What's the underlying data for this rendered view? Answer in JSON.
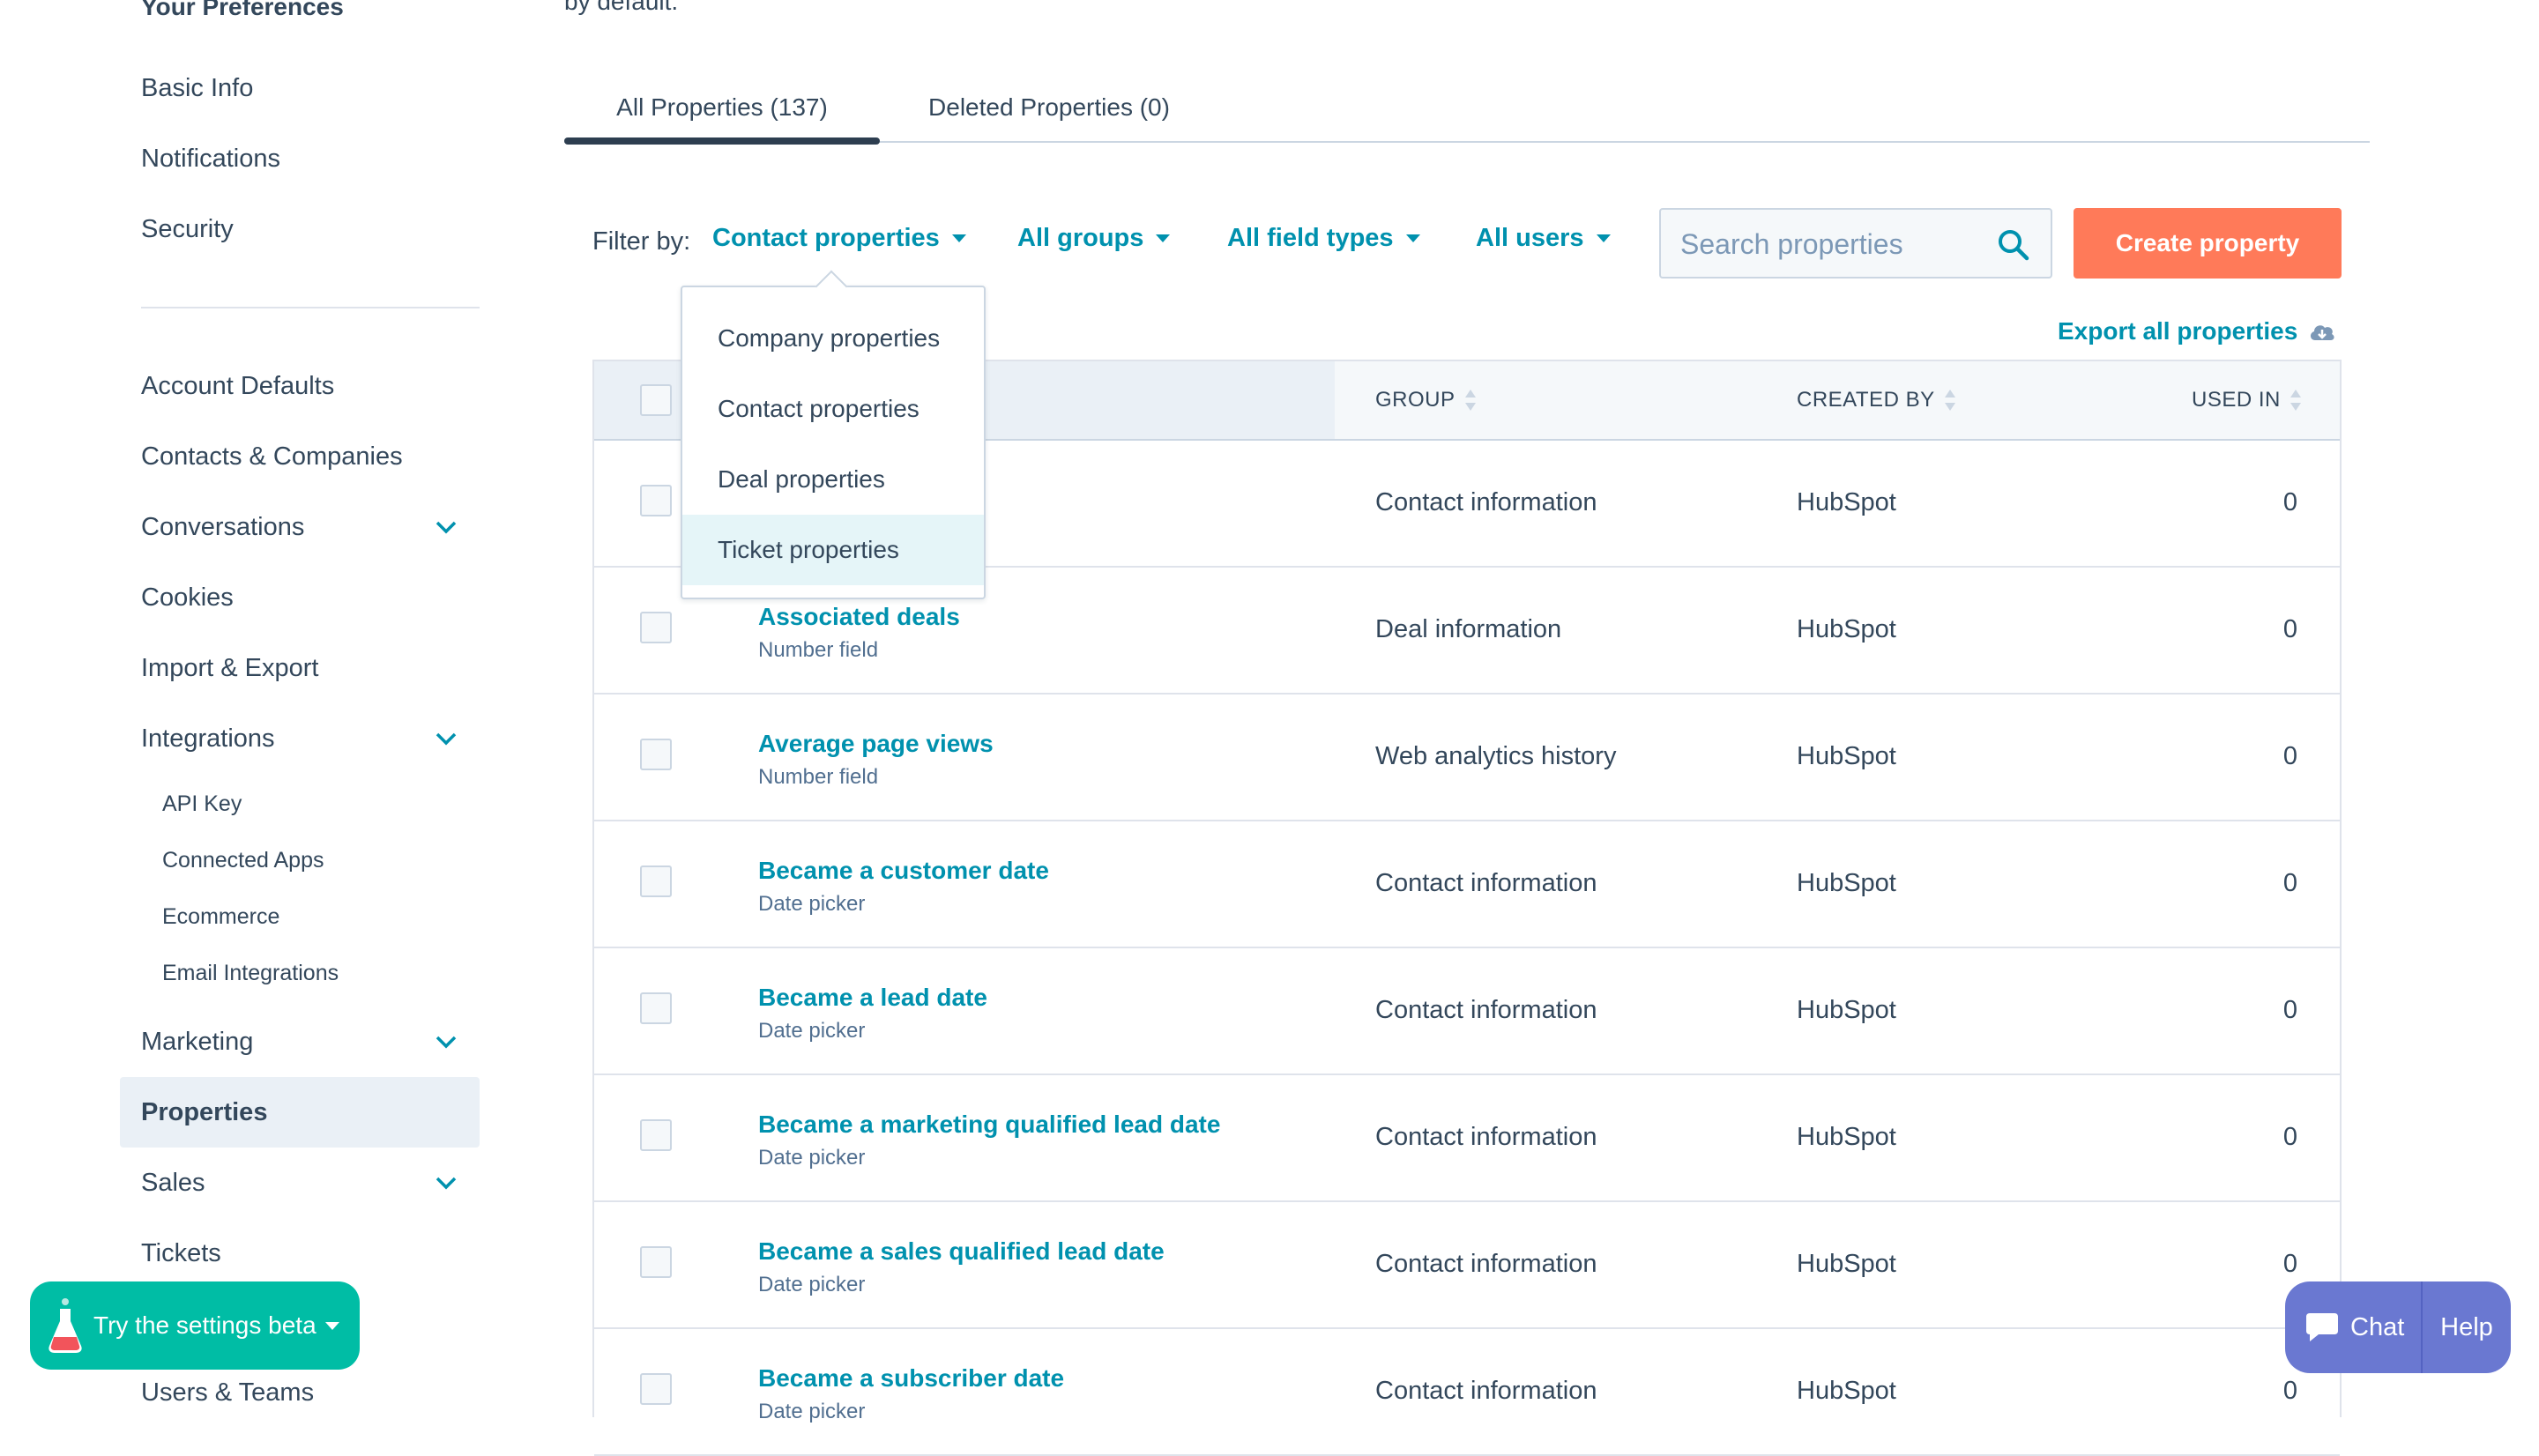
{
  "intro_text": "by default.",
  "sidebar": {
    "heading": "Your Preferences",
    "preferences": [
      {
        "label": "Basic Info"
      },
      {
        "label": "Notifications"
      },
      {
        "label": "Security"
      }
    ],
    "items": [
      {
        "label": "Account Defaults"
      },
      {
        "label": "Contacts & Companies"
      },
      {
        "label": "Conversations"
      },
      {
        "label": "Cookies"
      },
      {
        "label": "Import & Export"
      },
      {
        "label": "Integrations"
      },
      {
        "label": "Marketing"
      },
      {
        "label": "Properties"
      },
      {
        "label": "Sales"
      },
      {
        "label": "Tickets"
      },
      {
        "label": "Users & Teams"
      }
    ],
    "integrations_sub": [
      {
        "label": "API Key"
      },
      {
        "label": "Connected Apps"
      },
      {
        "label": "Ecommerce"
      },
      {
        "label": "Email Integrations"
      }
    ],
    "active_item": "Properties"
  },
  "tabs": [
    {
      "label": "All Properties (137)",
      "active": true
    },
    {
      "label": "Deleted Properties (0)",
      "active": false
    }
  ],
  "filters": {
    "label": "Filter by:",
    "object_type": "Contact properties",
    "groups": "All groups",
    "field_types": "All field types",
    "users": "All users"
  },
  "search": {
    "placeholder": "Search properties",
    "value": ""
  },
  "create_button": "Create property",
  "export_link": "Export all properties",
  "object_menu": {
    "options": [
      {
        "label": "Company properties"
      },
      {
        "label": "Contact properties"
      },
      {
        "label": "Deal properties"
      },
      {
        "label": "Ticket properties"
      }
    ],
    "highlighted": "Ticket properties"
  },
  "table": {
    "columns": {
      "group": "GROUP",
      "created_by": "CREATED BY",
      "used_in": "USED IN"
    },
    "rows": [
      {
        "name": "",
        "type": "",
        "group": "Contact information",
        "created_by": "HubSpot",
        "used_in": "0"
      },
      {
        "name": "Associated deals",
        "type": "Number field",
        "group": "Deal information",
        "created_by": "HubSpot",
        "used_in": "0"
      },
      {
        "name": "Average page views",
        "type": "Number field",
        "group": "Web analytics history",
        "created_by": "HubSpot",
        "used_in": "0"
      },
      {
        "name": "Became a customer date",
        "type": "Date picker",
        "group": "Contact information",
        "created_by": "HubSpot",
        "used_in": "0"
      },
      {
        "name": "Became a lead date",
        "type": "Date picker",
        "group": "Contact information",
        "created_by": "HubSpot",
        "used_in": "0"
      },
      {
        "name": "Became a marketing qualified lead date",
        "type": "Date picker",
        "group": "Contact information",
        "created_by": "HubSpot",
        "used_in": "0"
      },
      {
        "name": "Became a sales qualified lead date",
        "type": "Date picker",
        "group": "Contact information",
        "created_by": "HubSpot",
        "used_in": "0"
      },
      {
        "name": "Became a subscriber date",
        "type": "Date picker",
        "group": "Contact information",
        "created_by": "HubSpot",
        "used_in": "0"
      }
    ]
  },
  "beta_button": "Try the settings beta",
  "chat_widget": {
    "chat_label": "Chat",
    "help_label": "Help"
  },
  "colors": {
    "accent_link": "#0091ae",
    "primary_button": "#ff7a59",
    "beta_button": "#00bda5",
    "chat_widget": "#6a78d1",
    "text": "#33475b"
  }
}
